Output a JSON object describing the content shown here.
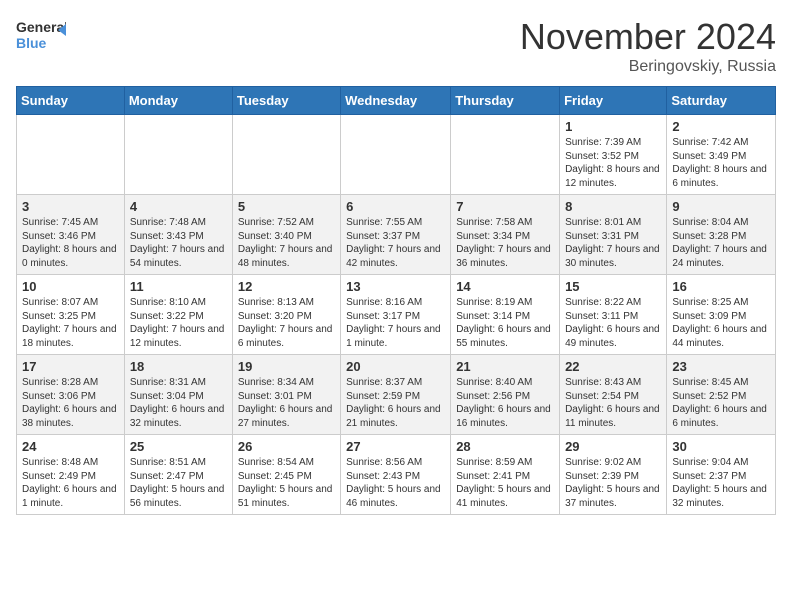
{
  "header": {
    "logo_line1": "General",
    "logo_line2": "Blue",
    "title": "November 2024",
    "subtitle": "Beringovskiy, Russia"
  },
  "days_of_week": [
    "Sunday",
    "Monday",
    "Tuesday",
    "Wednesday",
    "Thursday",
    "Friday",
    "Saturday"
  ],
  "weeks": [
    [
      {
        "day": "",
        "info": ""
      },
      {
        "day": "",
        "info": ""
      },
      {
        "day": "",
        "info": ""
      },
      {
        "day": "",
        "info": ""
      },
      {
        "day": "",
        "info": ""
      },
      {
        "day": "1",
        "info": "Sunrise: 7:39 AM\nSunset: 3:52 PM\nDaylight: 8 hours and 12 minutes."
      },
      {
        "day": "2",
        "info": "Sunrise: 7:42 AM\nSunset: 3:49 PM\nDaylight: 8 hours and 6 minutes."
      }
    ],
    [
      {
        "day": "3",
        "info": "Sunrise: 7:45 AM\nSunset: 3:46 PM\nDaylight: 8 hours and 0 minutes."
      },
      {
        "day": "4",
        "info": "Sunrise: 7:48 AM\nSunset: 3:43 PM\nDaylight: 7 hours and 54 minutes."
      },
      {
        "day": "5",
        "info": "Sunrise: 7:52 AM\nSunset: 3:40 PM\nDaylight: 7 hours and 48 minutes."
      },
      {
        "day": "6",
        "info": "Sunrise: 7:55 AM\nSunset: 3:37 PM\nDaylight: 7 hours and 42 minutes."
      },
      {
        "day": "7",
        "info": "Sunrise: 7:58 AM\nSunset: 3:34 PM\nDaylight: 7 hours and 36 minutes."
      },
      {
        "day": "8",
        "info": "Sunrise: 8:01 AM\nSunset: 3:31 PM\nDaylight: 7 hours and 30 minutes."
      },
      {
        "day": "9",
        "info": "Sunrise: 8:04 AM\nSunset: 3:28 PM\nDaylight: 7 hours and 24 minutes."
      }
    ],
    [
      {
        "day": "10",
        "info": "Sunrise: 8:07 AM\nSunset: 3:25 PM\nDaylight: 7 hours and 18 minutes."
      },
      {
        "day": "11",
        "info": "Sunrise: 8:10 AM\nSunset: 3:22 PM\nDaylight: 7 hours and 12 minutes."
      },
      {
        "day": "12",
        "info": "Sunrise: 8:13 AM\nSunset: 3:20 PM\nDaylight: 7 hours and 6 minutes."
      },
      {
        "day": "13",
        "info": "Sunrise: 8:16 AM\nSunset: 3:17 PM\nDaylight: 7 hours and 1 minute."
      },
      {
        "day": "14",
        "info": "Sunrise: 8:19 AM\nSunset: 3:14 PM\nDaylight: 6 hours and 55 minutes."
      },
      {
        "day": "15",
        "info": "Sunrise: 8:22 AM\nSunset: 3:11 PM\nDaylight: 6 hours and 49 minutes."
      },
      {
        "day": "16",
        "info": "Sunrise: 8:25 AM\nSunset: 3:09 PM\nDaylight: 6 hours and 44 minutes."
      }
    ],
    [
      {
        "day": "17",
        "info": "Sunrise: 8:28 AM\nSunset: 3:06 PM\nDaylight: 6 hours and 38 minutes."
      },
      {
        "day": "18",
        "info": "Sunrise: 8:31 AM\nSunset: 3:04 PM\nDaylight: 6 hours and 32 minutes."
      },
      {
        "day": "19",
        "info": "Sunrise: 8:34 AM\nSunset: 3:01 PM\nDaylight: 6 hours and 27 minutes."
      },
      {
        "day": "20",
        "info": "Sunrise: 8:37 AM\nSunset: 2:59 PM\nDaylight: 6 hours and 21 minutes."
      },
      {
        "day": "21",
        "info": "Sunrise: 8:40 AM\nSunset: 2:56 PM\nDaylight: 6 hours and 16 minutes."
      },
      {
        "day": "22",
        "info": "Sunrise: 8:43 AM\nSunset: 2:54 PM\nDaylight: 6 hours and 11 minutes."
      },
      {
        "day": "23",
        "info": "Sunrise: 8:45 AM\nSunset: 2:52 PM\nDaylight: 6 hours and 6 minutes."
      }
    ],
    [
      {
        "day": "24",
        "info": "Sunrise: 8:48 AM\nSunset: 2:49 PM\nDaylight: 6 hours and 1 minute."
      },
      {
        "day": "25",
        "info": "Sunrise: 8:51 AM\nSunset: 2:47 PM\nDaylight: 5 hours and 56 minutes."
      },
      {
        "day": "26",
        "info": "Sunrise: 8:54 AM\nSunset: 2:45 PM\nDaylight: 5 hours and 51 minutes."
      },
      {
        "day": "27",
        "info": "Sunrise: 8:56 AM\nSunset: 2:43 PM\nDaylight: 5 hours and 46 minutes."
      },
      {
        "day": "28",
        "info": "Sunrise: 8:59 AM\nSunset: 2:41 PM\nDaylight: 5 hours and 41 minutes."
      },
      {
        "day": "29",
        "info": "Sunrise: 9:02 AM\nSunset: 2:39 PM\nDaylight: 5 hours and 37 minutes."
      },
      {
        "day": "30",
        "info": "Sunrise: 9:04 AM\nSunset: 2:37 PM\nDaylight: 5 hours and 32 minutes."
      }
    ]
  ]
}
